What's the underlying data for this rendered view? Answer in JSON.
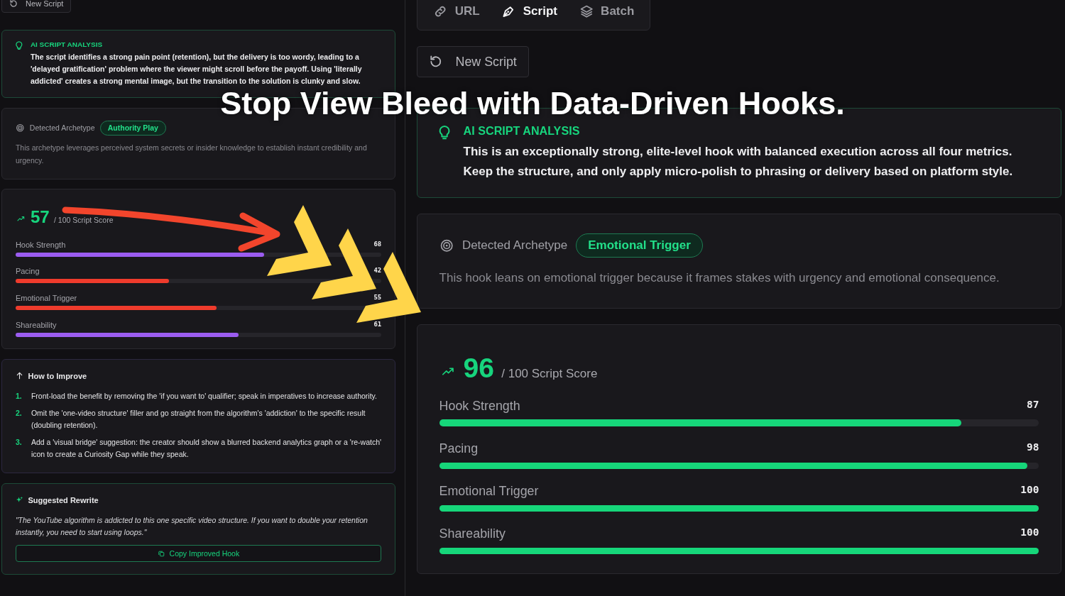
{
  "left_panel": {
    "new_script_button": "New Script",
    "analysis": {
      "title": "AI SCRIPT ANALYSIS",
      "text": "The script identifies a strong pain point (retention), but the delivery is too wordy, leading to a 'delayed gratification' problem where the viewer might scroll before the payoff. Using 'literally addicted' creates a strong mental image, but the transition to the solution is clunky and slow."
    },
    "archetype": {
      "label": "Detected Archetype",
      "tag": "Authority Play",
      "description": "This archetype leverages perceived system secrets or insider knowledge to establish instant credibility and urgency."
    },
    "score": {
      "value": "57",
      "suffix": "/ 100 Script Score",
      "metrics": [
        {
          "name": "Hook Strength",
          "value": "68",
          "level": 0.68,
          "color": "#9b5cf0"
        },
        {
          "name": "Pacing",
          "value": "42",
          "level": 0.42,
          "color": "#ef3b2c"
        },
        {
          "name": "Emotional Trigger",
          "value": "55",
          "level": 0.55,
          "color": "#ef3b2c"
        },
        {
          "name": "Shareability",
          "value": "61",
          "level": 0.61,
          "color": "#9b5cf0"
        }
      ]
    },
    "improve": {
      "title": "How to Improve",
      "items": [
        {
          "number": "1.",
          "text": "Front-load the benefit by removing the 'if you want to' qualifier; speak in imperatives to increase authority."
        },
        {
          "number": "2.",
          "text": "Omit the 'one-video structure' filler and go straight from the algorithm's 'addiction' to the specific result (doubling retention)."
        },
        {
          "number": "3.",
          "text": "Add a 'visual bridge' suggestion: the creator should show a blurred backend analytics graph or a 're-watch' icon to create a Curiosity Gap while they speak."
        }
      ]
    },
    "rewrite": {
      "title": "Suggested Rewrite",
      "quote": "\"The YouTube algorithm is addicted to this one specific video structure. If you want to double your retention instantly, you need to start using loops.\"",
      "copy_button": "Copy Improved Hook"
    }
  },
  "right_panel": {
    "tabs": [
      {
        "label": "URL",
        "selected": false
      },
      {
        "label": "Script",
        "selected": true
      },
      {
        "label": "Batch",
        "selected": false
      }
    ],
    "new_script_button": "New Script",
    "analysis": {
      "title": "AI SCRIPT ANALYSIS",
      "text": "This is an exceptionally strong, elite-level hook with balanced execution across all four metrics. Keep the structure, and only apply micro-polish to phrasing or delivery based on platform style."
    },
    "archetype": {
      "label": "Detected Archetype",
      "tag": "Emotional Trigger",
      "description": "This hook leans on emotional trigger because it frames stakes with urgency and emotional consequence."
    },
    "score": {
      "value": "96",
      "suffix": "/ 100 Script Score",
      "metrics": [
        {
          "name": "Hook Strength",
          "value": "87",
          "level": 0.87,
          "color": "#16d67a"
        },
        {
          "name": "Pacing",
          "value": "98",
          "level": 0.98,
          "color": "#16d67a"
        },
        {
          "name": "Emotional Trigger",
          "value": "100",
          "level": 1.0,
          "color": "#16d67a"
        },
        {
          "name": "Shareability",
          "value": "100",
          "level": 1.0,
          "color": "#16d67a"
        }
      ]
    }
  },
  "headline": "Stop View Bleed with Data-Driven Hooks."
}
